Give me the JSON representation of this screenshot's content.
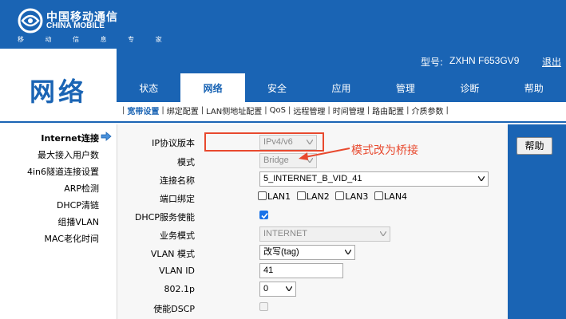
{
  "brand": {
    "name_cn": "中国移动通信",
    "name_en": "CHINA MOBILE",
    "slogan": "移 动 信 息 专 家",
    "color": "#1a64b4"
  },
  "header": {
    "model_label": "型号:",
    "model_value": "ZXHN F653GV9",
    "logout": "退出"
  },
  "section_title": "网络",
  "tabs": [
    {
      "label": "状态",
      "active": false
    },
    {
      "label": "网络",
      "active": true
    },
    {
      "label": "安全",
      "active": false
    },
    {
      "label": "应用",
      "active": false
    },
    {
      "label": "管理",
      "active": false
    },
    {
      "label": "诊断",
      "active": false
    },
    {
      "label": "帮助",
      "active": false
    }
  ],
  "subnav": [
    {
      "label": "宽带设置",
      "active": true
    },
    {
      "label": "绑定配置",
      "active": false
    },
    {
      "label": "LAN侧地址配置",
      "active": false
    },
    {
      "label": "QoS",
      "active": false
    },
    {
      "label": "远程管理",
      "active": false
    },
    {
      "label": "时间管理",
      "active": false
    },
    {
      "label": "路由配置",
      "active": false
    },
    {
      "label": "介质参数",
      "active": false
    }
  ],
  "left_menu": [
    {
      "label": "Internet连接",
      "active": true,
      "icon": "arrow-right-icon"
    },
    {
      "label": "最大接入用户数",
      "active": false
    },
    {
      "label": "4in6隧道连接设置",
      "active": false
    },
    {
      "label": "ARP检测",
      "active": false
    },
    {
      "label": "DHCP清链",
      "active": false
    },
    {
      "label": "组播VLAN",
      "active": false
    },
    {
      "label": "MAC老化时间",
      "active": false
    }
  ],
  "form": {
    "ip_version": {
      "label": "IP协议版本",
      "value": "IPv4/v6",
      "disabled": true
    },
    "mode": {
      "label": "模式",
      "value": "Bridge",
      "disabled": true
    },
    "connection_name": {
      "label": "连接名称",
      "value": "5_INTERNET_B_VID_41"
    },
    "port_binding": {
      "label": "端口绑定",
      "ports": [
        {
          "label": "LAN1",
          "checked": false
        },
        {
          "label": "LAN2",
          "checked": false
        },
        {
          "label": "LAN3",
          "checked": false
        },
        {
          "label": "LAN4",
          "checked": false
        }
      ]
    },
    "dhcp_enable": {
      "label": "DHCP服务使能",
      "checked": true
    },
    "service_mode": {
      "label": "业务模式",
      "value": "INTERNET",
      "disabled": true
    },
    "vlan_mode": {
      "label": "VLAN 模式",
      "value": "改写(tag)"
    },
    "vlan_id": {
      "label": "VLAN ID",
      "value": "41"
    },
    "dot1p": {
      "label": "802.1p",
      "value": "0"
    },
    "dscp_enable": {
      "label": "使能DSCP",
      "checked": false,
      "disabled": true
    }
  },
  "annotation": {
    "text": "模式改为桥接",
    "color": "#e8492e"
  },
  "help_button": "帮助"
}
